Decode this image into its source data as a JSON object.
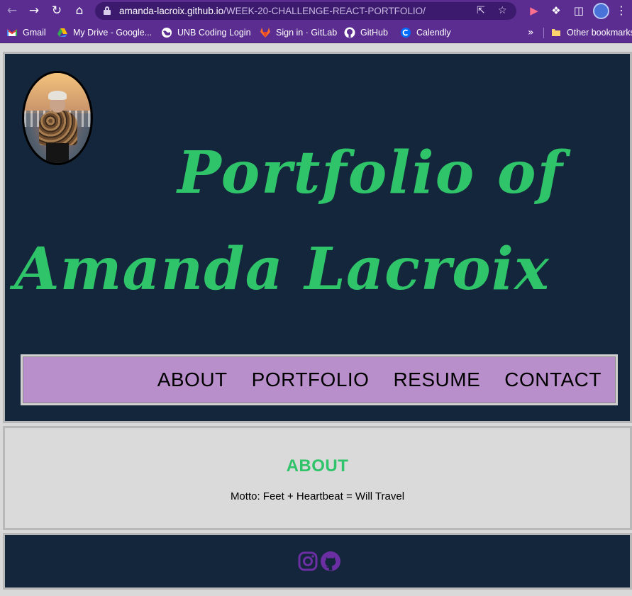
{
  "browser": {
    "url_host": "amanda-lacroix.github.io",
    "url_path": "/WEEK-20-CHALLENGE-REACT-PORTFOLIO/",
    "icons": {
      "back": "arrow-left-icon",
      "forward": "arrow-right-icon",
      "reload": "reload-icon",
      "home": "home-icon",
      "share": "share-icon",
      "bookmark": "star-icon"
    },
    "bookmarks": [
      {
        "label": "Gmail",
        "icon": "gmail-icon"
      },
      {
        "label": "My Drive - Google...",
        "icon": "google-drive-icon"
      },
      {
        "label": "UNB Coding Login",
        "icon": "globe-icon"
      },
      {
        "label": "Sign in · GitLab",
        "icon": "gitlab-icon"
      },
      {
        "label": "GitHub",
        "icon": "github-icon"
      },
      {
        "label": "Calendly",
        "icon": "calendly-icon"
      }
    ],
    "bookmarks_more": "»",
    "other_bookmarks": "Other bookmarks"
  },
  "header": {
    "title_line1": "Portfolio of",
    "title_line2": "Amanda Lacroix",
    "nav": [
      "ABOUT",
      "PORTFOLIO",
      "RESUME",
      "CONTACT"
    ]
  },
  "about": {
    "heading": "ABOUT",
    "motto": "Motto: Feet + Heartbeat = Will Travel"
  },
  "footer": {
    "social": [
      {
        "icon": "instagram-icon"
      },
      {
        "icon": "github-icon"
      }
    ]
  },
  "colors": {
    "header_bg": "#13263b",
    "accent_green": "#2fc46a",
    "nav_bg": "#b98fcb",
    "about_bg": "#dadada",
    "social_icon": "#6b2fa3",
    "chrome_purple": "#5b2d91"
  }
}
